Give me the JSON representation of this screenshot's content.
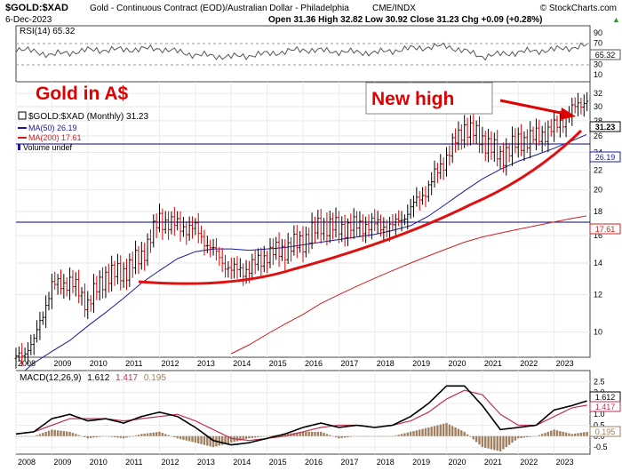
{
  "header": {
    "symbol": "$GOLD:$XAD",
    "description": "Gold - Continuous Contract (EOD)/Australian Dollar - Philadelphia",
    "exchange": "CME/INDX",
    "date": "6-Dec-2023",
    "ohlc": "Open 31.36  High 32.82  Low 30.92  Close 31.23  Chg +0.09 (+0.28%)",
    "up_arrow": "▲",
    "copyright": "© StockCharts.com"
  },
  "rsi": {
    "label": "RSI(14) 65.32",
    "value_badge": "65.32",
    "ticks": [
      "90",
      "70",
      "50",
      "30",
      "10"
    ]
  },
  "price": {
    "legend_main": "$GOLD:$XAD (Monthly) 31.23",
    "legend_ma50": "MA(50) 26.19",
    "legend_ma200": "MA(200) 17.61",
    "legend_volume": "Volume undef",
    "badge_last": "31.23",
    "badge_ma50": "26.19",
    "badge_ma200": "17.61",
    "annotation_gold": "Gold in A$",
    "annotation_high": "New high",
    "ticks": [
      "32",
      "30",
      "28",
      "26",
      "24",
      "22",
      "20",
      "18",
      "16",
      "14",
      "12",
      "10"
    ]
  },
  "macd": {
    "label_prefix": "MACD(12,26,9)",
    "v1": "1.612",
    "v2": "1.417",
    "v3": "0.195",
    "badge_macd": "1.612",
    "badge_signal": "1.417",
    "badge_hist": "0.195",
    "ticks": [
      "2.5",
      "2.0",
      "1.5",
      "1.0",
      "0.5",
      "0.0",
      "-0.5"
    ]
  },
  "x_labels": [
    "2008",
    "2009",
    "2010",
    "2011",
    "2012",
    "2013",
    "2014",
    "2015",
    "2016",
    "2017",
    "2018",
    "2019",
    "2020",
    "2021",
    "2022",
    "2023"
  ],
  "colors": {
    "up": "#000000",
    "down": "#e00000",
    "ma50": "#1a1aa0",
    "ma200": "#d02020",
    "annotation": "#e00000",
    "horizontal_line": "#00008b",
    "macd_line": "#000000",
    "signal_line": "#c03050",
    "histogram": "#a08060"
  },
  "chart_data": {
    "type": "line",
    "title": "Gold in A$",
    "x": [
      2008,
      2008.5,
      2009,
      2009.5,
      2010,
      2010.5,
      2011,
      2011.5,
      2012,
      2012.5,
      2013,
      2013.5,
      2014,
      2014.5,
      2015,
      2015.5,
      2016,
      2016.5,
      2017,
      2017.5,
      2018,
      2018.5,
      2019,
      2019.5,
      2020,
      2020.5,
      2021,
      2021.5,
      2022,
      2022.5,
      2023,
      2023.5,
      2023.9
    ],
    "series": [
      {
        "name": "$GOLD:$XAD (Monthly)",
        "values": [
          8.8,
          9.5,
          12.5,
          12.8,
          11.5,
          13.2,
          13.4,
          14.5,
          17.3,
          16.8,
          16.5,
          14.8,
          13.5,
          13.6,
          14.6,
          15.0,
          15.6,
          16.9,
          16.6,
          16.8,
          16.9,
          16.7,
          18.2,
          20.3,
          23.5,
          27.2,
          25.6,
          23.5,
          25.3,
          25.9,
          27.0,
          29.4,
          31.23
        ]
      },
      {
        "name": "MA(50)",
        "values": [
          8.0,
          8.6,
          9.1,
          9.6,
          10.3,
          11.0,
          11.8,
          12.7,
          13.5,
          14.3,
          14.8,
          15.0,
          15.0,
          14.9,
          15.0,
          15.1,
          15.3,
          15.5,
          15.7,
          15.9,
          16.1,
          16.4,
          16.8,
          17.6,
          18.7,
          19.9,
          21.1,
          22.1,
          23.0,
          23.7,
          24.5,
          25.4,
          26.19
        ]
      },
      {
        "name": "MA(200)",
        "values": [
          null,
          null,
          null,
          null,
          null,
          null,
          null,
          null,
          null,
          null,
          null,
          null,
          9.0,
          9.4,
          9.9,
          10.4,
          10.9,
          11.5,
          12.0,
          12.5,
          13.0,
          13.5,
          14.0,
          14.5,
          15.0,
          15.5,
          15.9,
          16.2,
          16.5,
          16.8,
          17.1,
          17.4,
          17.61
        ]
      }
    ],
    "last_close": 31.23,
    "ma50_last": 26.19,
    "ma200_last": 17.61,
    "horizontal_levels": [
      28,
      17.6
    ],
    "ylim": [
      9,
      33
    ],
    "y_scale": "log",
    "rsi": {
      "x": [
        2008,
        2009,
        2010,
        2011,
        2012,
        2013,
        2014,
        2015,
        2016,
        2017,
        2018,
        2019,
        2020,
        2021,
        2022,
        2023,
        2023.9
      ],
      "values": [
        60,
        48,
        57,
        58,
        60,
        48,
        44,
        50,
        58,
        54,
        52,
        60,
        65,
        45,
        53,
        58,
        65.32
      ],
      "ylim": [
        0,
        100
      ]
    },
    "macd": {
      "x": [
        2008,
        2008.5,
        2009,
        2009.5,
        2010,
        2010.5,
        2011,
        2011.5,
        2012,
        2012.5,
        2013,
        2013.5,
        2014,
        2014.5,
        2015,
        2015.5,
        2016,
        2016.5,
        2017,
        2017.5,
        2018,
        2018.5,
        2019,
        2019.5,
        2020,
        2020.5,
        2021,
        2021.5,
        2022,
        2022.5,
        2023,
        2023.5,
        2023.9
      ],
      "macd": [
        0.1,
        0.2,
        0.8,
        1.0,
        0.7,
        0.8,
        0.6,
        0.9,
        1.1,
        0.9,
        0.4,
        -0.2,
        -0.4,
        -0.3,
        -0.1,
        0.1,
        0.4,
        0.6,
        0.4,
        0.5,
        0.4,
        0.5,
        0.9,
        1.5,
        2.3,
        2.3,
        1.4,
        0.3,
        0.4,
        0.5,
        1.2,
        1.4,
        1.612
      ],
      "signal": [
        0.1,
        0.2,
        0.5,
        0.8,
        0.8,
        0.8,
        0.7,
        0.8,
        0.9,
        1.0,
        0.7,
        0.3,
        -0.1,
        -0.2,
        -0.1,
        0.0,
        0.2,
        0.4,
        0.5,
        0.5,
        0.4,
        0.5,
        0.7,
        1.1,
        1.7,
        2.1,
        1.9,
        1.0,
        0.5,
        0.5,
        0.9,
        1.3,
        1.417
      ],
      "histogram": [
        0.0,
        0.0,
        0.3,
        0.2,
        -0.1,
        0.0,
        -0.1,
        0.1,
        0.2,
        -0.1,
        -0.3,
        -0.5,
        -0.3,
        -0.1,
        0.0,
        0.1,
        0.2,
        0.2,
        -0.1,
        0.0,
        0.0,
        0.0,
        0.2,
        0.4,
        0.6,
        0.2,
        -0.5,
        -0.7,
        -0.1,
        0.0,
        0.3,
        0.1,
        0.195
      ],
      "ylim": [
        -0.7,
        2.8
      ]
    }
  }
}
